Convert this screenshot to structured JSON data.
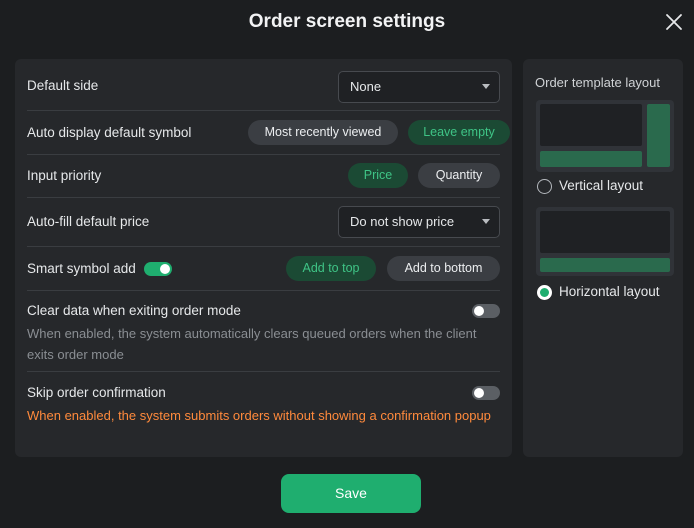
{
  "dialog": {
    "title": "Order screen settings",
    "close_icon": "close-icon",
    "save_label": "Save"
  },
  "settings": {
    "default_side": {
      "label": "Default side",
      "value": "None"
    },
    "auto_display": {
      "label": "Auto display default symbol",
      "options": [
        "Most recently viewed",
        "Leave empty"
      ],
      "selected": "Leave empty"
    },
    "input_priority": {
      "label": "Input priority",
      "options": [
        "Price",
        "Quantity"
      ],
      "selected": "Price"
    },
    "auto_fill": {
      "label": "Auto-fill default price",
      "value": "Do not show price"
    },
    "smart_add": {
      "label": "Smart symbol add",
      "enabled": true,
      "options": [
        "Add to top",
        "Add to bottom"
      ],
      "selected": "Add to top"
    },
    "clear_data": {
      "label": "Clear data when exiting order mode",
      "enabled": false,
      "description": "When enabled, the system automatically clears queued orders when the client exits order mode"
    },
    "skip_confirm": {
      "label": "Skip order confirmation",
      "enabled": false,
      "description": "When enabled, the system submits orders without showing a confirmation popup"
    }
  },
  "template_layout": {
    "title": "Order template layout",
    "options": [
      {
        "label": "Vertical layout",
        "selected": false
      },
      {
        "label": "Horizontal layout",
        "selected": true
      }
    ]
  },
  "colors": {
    "accent": "#1fae6f",
    "accent_dark": "#1b4a34",
    "warning": "#ff8a3c"
  }
}
